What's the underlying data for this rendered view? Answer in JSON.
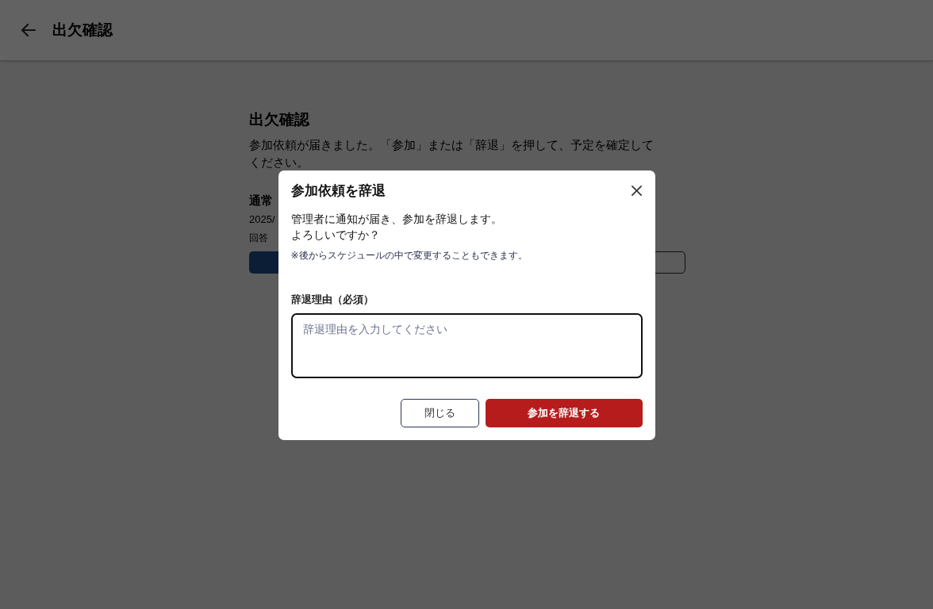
{
  "header": {
    "title": "出欠確認"
  },
  "page": {
    "heading": "出欠確認",
    "description": "参加依頼が届きました。「参加」または「辞退」を押して、予定を確定してください。",
    "event_title": "通常",
    "event_date": "2025/",
    "deadline": "回答"
  },
  "dialog": {
    "title": "参加依頼を辞退",
    "message_lines": [
      "管理者に通知が届き、参加を辞退します。",
      "よろしいですか？"
    ],
    "note": "※後からスケジュールの中で変更することもできます。",
    "field_label": "辞退理由（必須）",
    "field": {
      "placeholder": "辞退理由を入力してください"
    },
    "buttons": [
      {
        "label": "閉じる",
        "kind": "secondary"
      },
      {
        "label": "参加を辞退する",
        "kind": "danger"
      }
    ]
  }
}
